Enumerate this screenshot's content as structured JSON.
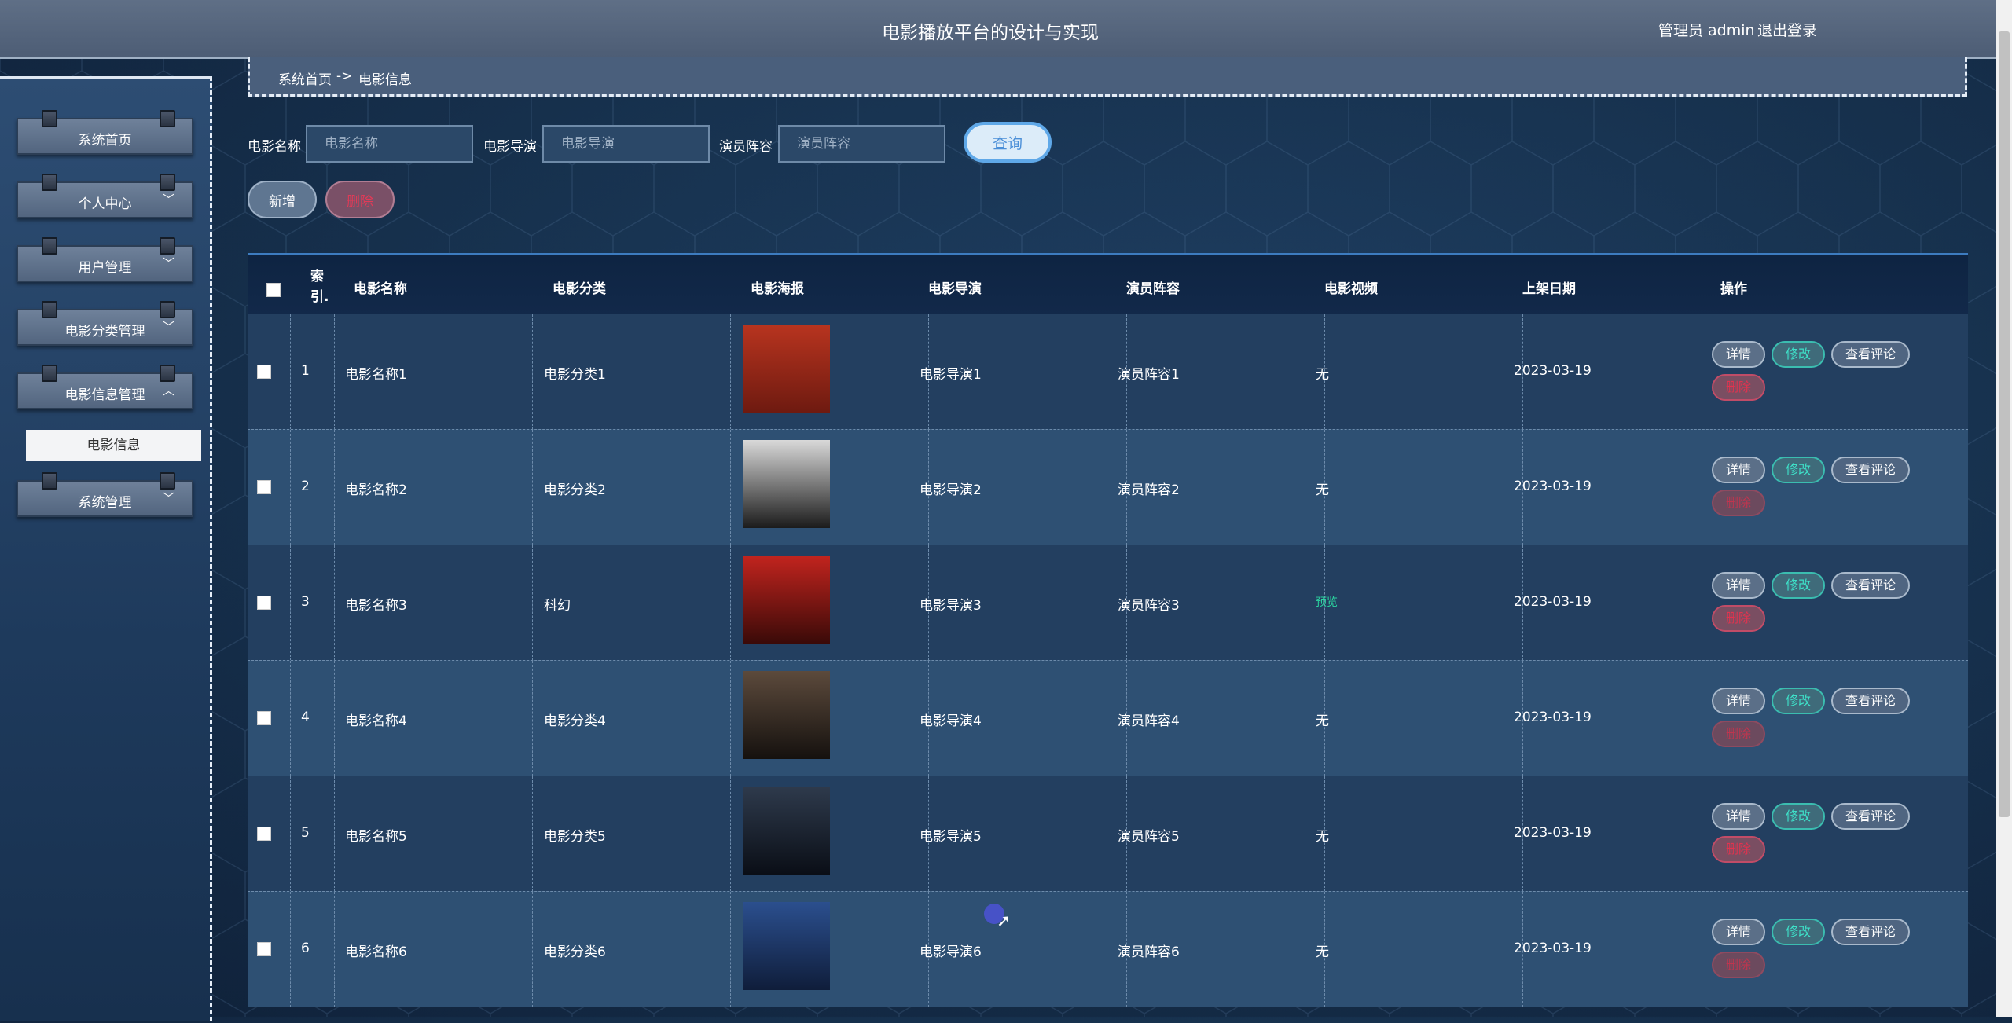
{
  "header": {
    "title": "电影播放平台的设计与实现",
    "user": "管理员 admin",
    "logout": "退出登录"
  },
  "sidebar": {
    "items": [
      {
        "label": "系统首页",
        "chevron": ""
      },
      {
        "label": "个人中心",
        "chevron": "﹀"
      },
      {
        "label": "用户管理",
        "chevron": "﹀"
      },
      {
        "label": "电影分类管理",
        "chevron": "﹀"
      },
      {
        "label": "电影信息管理",
        "chevron": "︿"
      },
      {
        "label": "系统管理",
        "chevron": "﹀"
      }
    ],
    "submenu": "电影信息"
  },
  "breadcrumb": {
    "home": "系统首页",
    "separator": "->",
    "current": "电影信息"
  },
  "search": {
    "name_label": "电影名称",
    "name_placeholder": "电影名称",
    "director_label": "电影导演",
    "director_placeholder": "电影导演",
    "cast_label": "演员阵容",
    "cast_placeholder": "演员阵容",
    "query": "查询"
  },
  "actions": {
    "add": "新增",
    "delete": "删除"
  },
  "table": {
    "headers": {
      "index_1": "索",
      "index_2": "引.",
      "name": "电影名称",
      "category": "电影分类",
      "poster": "电影海报",
      "director": "电影导演",
      "cast": "演员阵容",
      "video": "电影视频",
      "date": "上架日期",
      "ops": "操作"
    },
    "buttons": {
      "detail": "详情",
      "edit": "修改",
      "comments": "查看评论",
      "delete": "删除"
    },
    "rows": [
      {
        "idx": "1",
        "name": "电影名称1",
        "category": "电影分类1",
        "director": "电影导演1",
        "cast": "演员阵容1",
        "video": "无",
        "date": "2023-03-19",
        "poster_colors": [
          "#b8341f",
          "#6e1a10"
        ]
      },
      {
        "idx": "2",
        "name": "电影名称2",
        "category": "电影分类2",
        "director": "电影导演2",
        "cast": "演员阵容2",
        "video": "无",
        "date": "2023-03-19",
        "poster_colors": [
          "#d9d9d9",
          "#1b1b1b"
        ]
      },
      {
        "idx": "3",
        "name": "电影名称3",
        "category": "科幻",
        "director": "电影导演3",
        "cast": "演员阵容3",
        "video": "预览",
        "date": "2023-03-19",
        "poster_colors": [
          "#c2241e",
          "#3a0a08"
        ]
      },
      {
        "idx": "4",
        "name": "电影名称4",
        "category": "电影分类4",
        "director": "电影导演4",
        "cast": "演员阵容4",
        "video": "无",
        "date": "2023-03-19",
        "poster_colors": [
          "#5c4a3c",
          "#15110e"
        ]
      },
      {
        "idx": "5",
        "name": "电影名称5",
        "category": "电影分类5",
        "director": "电影导演5",
        "cast": "演员阵容5",
        "video": "无",
        "date": "2023-03-19",
        "poster_colors": [
          "#2e3a4c",
          "#0a0e16"
        ]
      },
      {
        "idx": "6",
        "name": "电影名称6",
        "category": "电影分类6",
        "director": "电影导演6",
        "cast": "演员阵容6",
        "video": "无",
        "date": "2023-03-19",
        "poster_colors": [
          "#2b4f8e",
          "#0f1d3a"
        ]
      }
    ]
  }
}
